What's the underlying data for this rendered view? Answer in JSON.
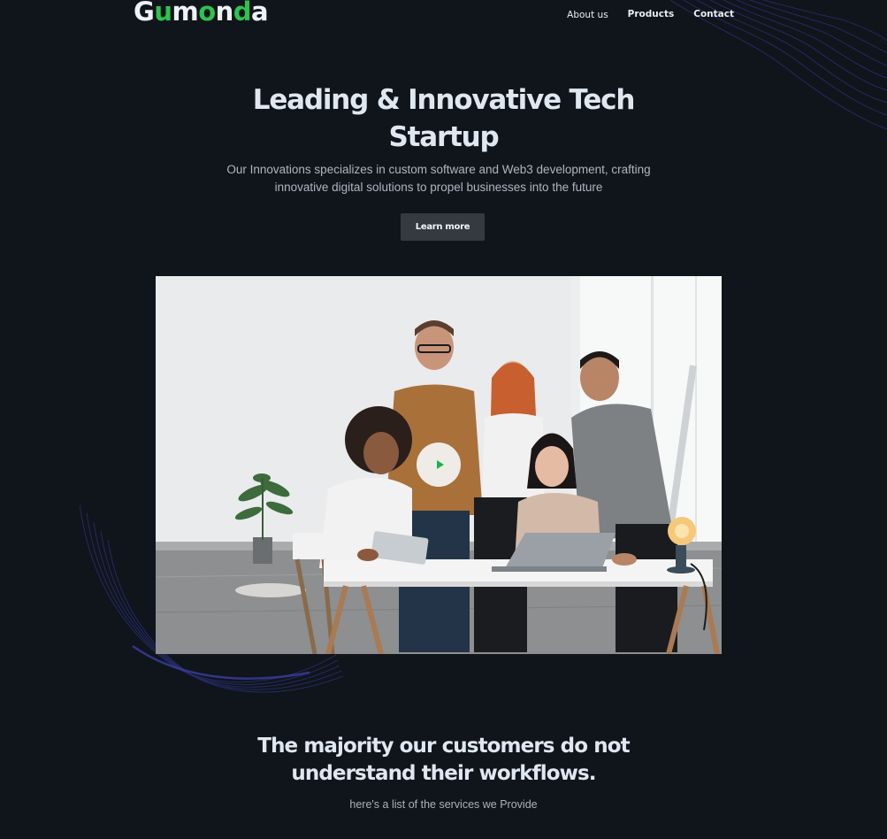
{
  "header": {
    "logo_parts": [
      "G",
      "u",
      "m",
      "o",
      "n",
      "d",
      "a"
    ],
    "nav": [
      "About us",
      "Products",
      "Contact"
    ]
  },
  "hero": {
    "title_line1": "Leading & Innovative Tech",
    "title_line2": "Startup",
    "subtitle_line1": "Our Innovations specializes in custom software and Web3 development, crafting",
    "subtitle_line2": "innovative digital solutions to propel businesses into the future",
    "cta_label": "Learn more"
  },
  "media": {
    "icon": "play-icon"
  },
  "section": {
    "title_line1": "The majority our customers do not",
    "title_line2": "understand their workflows.",
    "subtitle": "here's a list of the services we Provide"
  },
  "colors": {
    "background": "#10151b",
    "accent_green": "#2ec24e",
    "button": "#353a41",
    "wave_lines": "#2a2f7a"
  }
}
